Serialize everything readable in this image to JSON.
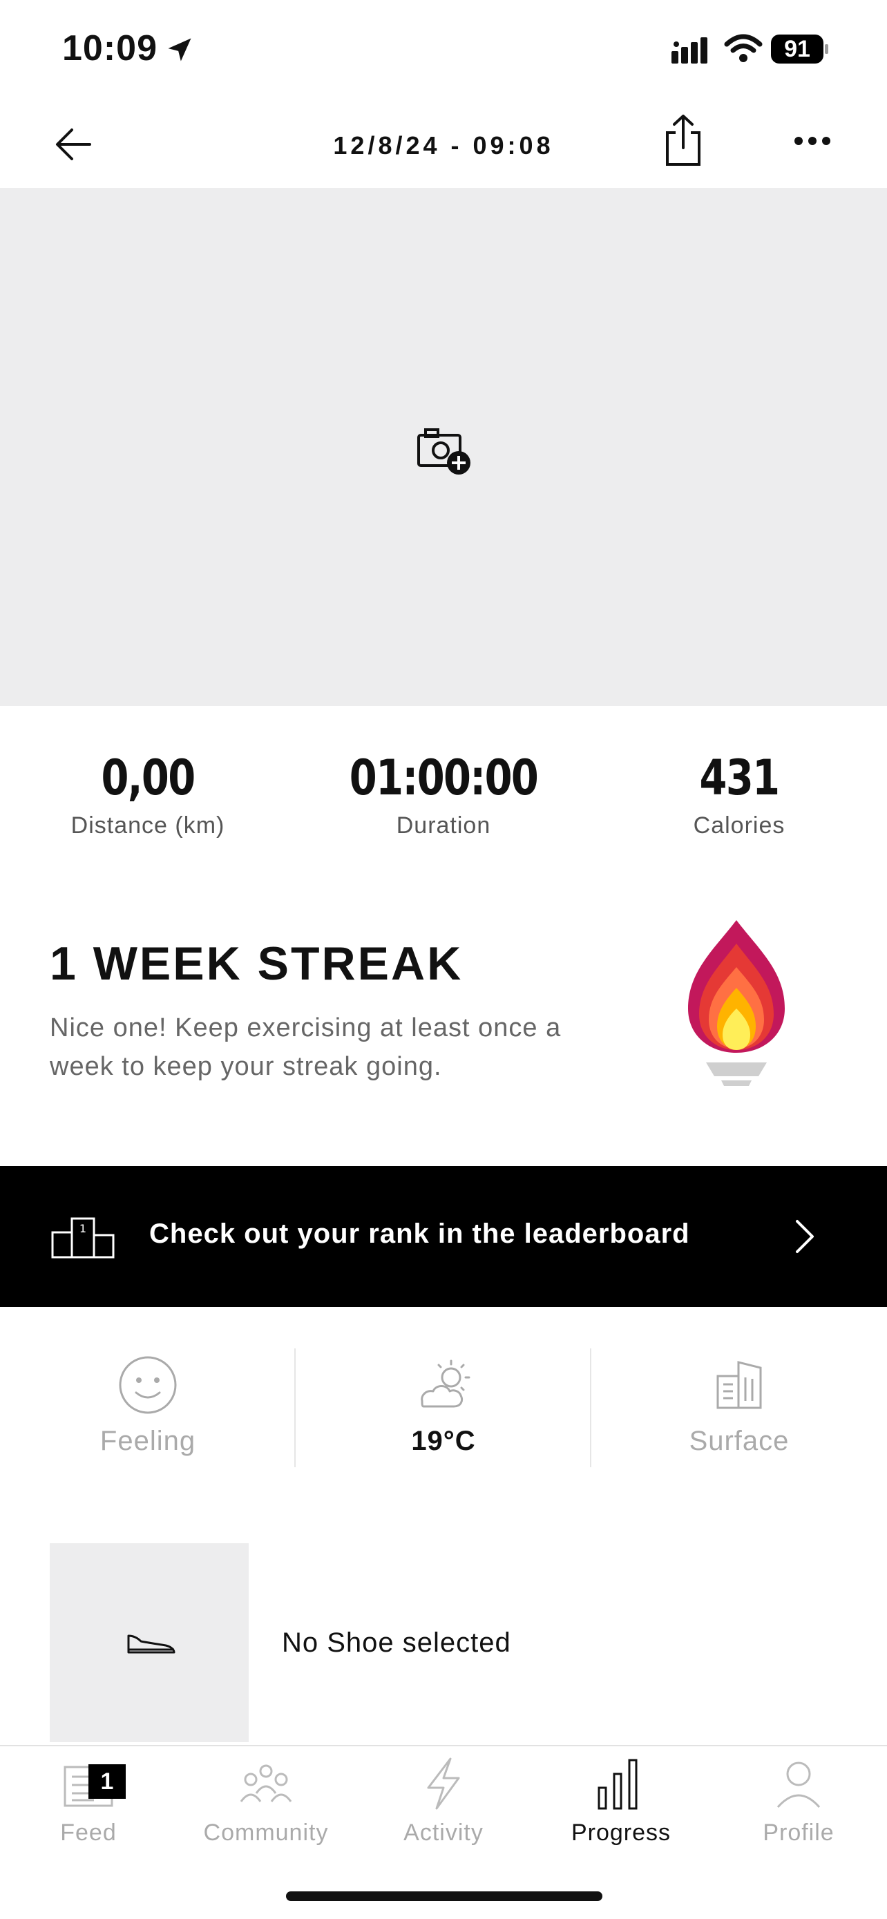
{
  "status_bar": {
    "time": "10:09",
    "battery": "91",
    "icons": [
      "location-arrow-icon",
      "cellular-signal-icon",
      "wifi-icon",
      "battery-icon"
    ]
  },
  "header": {
    "title": "12/8/24 - 09:08",
    "icons": [
      "back-arrow-icon",
      "share-icon",
      "more-icon"
    ]
  },
  "photo": {
    "icon": "add-photo-icon"
  },
  "stats": [
    {
      "value": "0,00",
      "label": "Distance (km)"
    },
    {
      "value": "01:00:00",
      "label": "Duration"
    },
    {
      "value": "431",
      "label": "Calories"
    }
  ],
  "streak": {
    "title": "1 WEEK STREAK",
    "description": "Nice one! Keep exercising at least once a week to keep your streak going.",
    "icon": "torch-flame-icon"
  },
  "leaderboard": {
    "label": "Check out your rank in the leaderboard",
    "icon": "podium-icon"
  },
  "conditions": [
    {
      "label": "Feeling",
      "icon": "smiley-icon",
      "set": false
    },
    {
      "label": "19°C",
      "icon": "partly-cloudy-icon",
      "set": true
    },
    {
      "label": "Surface",
      "icon": "buildings-icon",
      "set": false
    }
  ],
  "shoe": {
    "label": "No Shoe selected",
    "icon": "shoe-icon"
  },
  "tabs": [
    {
      "label": "Feed",
      "icon": "feed-icon",
      "badge": "1"
    },
    {
      "label": "Community",
      "icon": "community-icon"
    },
    {
      "label": "Activity",
      "icon": "lightning-icon"
    },
    {
      "label": "Progress",
      "icon": "bar-chart-icon",
      "active": true
    },
    {
      "label": "Profile",
      "icon": "person-icon"
    }
  ],
  "colors": {
    "photo_bg": "#ededee",
    "banner_bg": "#000000",
    "flame_outer": "#c2185b",
    "flame_mid": "#ff5722",
    "flame_inner": "#ffeb3b"
  }
}
